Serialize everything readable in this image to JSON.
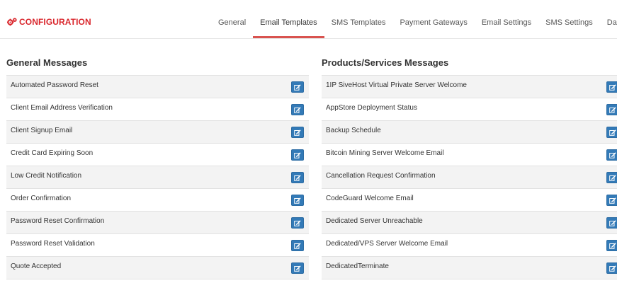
{
  "header": {
    "brand_icon": "gears-icon",
    "brand_title": "CONFIGURATION",
    "brand_color": "#d9262c",
    "tabs": [
      {
        "label": "General",
        "active": false
      },
      {
        "label": "Email Templates",
        "active": true
      },
      {
        "label": "SMS Templates",
        "active": false
      },
      {
        "label": "Payment Gateways",
        "active": false
      },
      {
        "label": "Email Settings",
        "active": false
      },
      {
        "label": "SMS Settings",
        "active": false
      },
      {
        "label": "Data Export",
        "active": false
      }
    ]
  },
  "general_messages": {
    "title": "General Messages",
    "items": [
      "Automated Password Reset",
      "Client Email Address Verification",
      "Client Signup Email",
      "Credit Card Expiring Soon",
      "Low Credit Notification",
      "Order Confirmation",
      "Password Reset Confirmation",
      "Password Reset Validation",
      "Quote Accepted"
    ]
  },
  "product_messages": {
    "title": "Products/Services Messages",
    "items": [
      "1IP SiveHost Virtual Private Server Welcome",
      "AppStore Deployment Status",
      "Backup Schedule",
      "Bitcoin Mining Server Welcome Email",
      "Cancellation Request Confirmation",
      "CodeGuard Welcome Email",
      "Dedicated Server Unreachable",
      "Dedicated/VPS Server Welcome Email",
      "DedicatedTerminate"
    ]
  },
  "edit_icon": "edit-icon",
  "colors": {
    "accent": "#d9534f",
    "edit_button": "#337ab7",
    "row_alt": "#f3f3f3"
  }
}
